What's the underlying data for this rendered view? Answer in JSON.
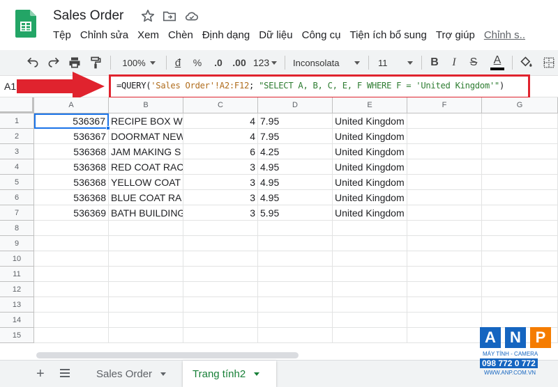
{
  "app": {
    "doc_title": "Sales Order",
    "menu": [
      "Tệp",
      "Chỉnh sửa",
      "Xem",
      "Chèn",
      "Định dạng",
      "Dữ liệu",
      "Công cụ",
      "Tiện ích bổ sung",
      "Trợ giúp",
      "Chỉnh s.."
    ]
  },
  "toolbar": {
    "zoom": "100%",
    "currency": "đ",
    "percent": "%",
    "decrease_decimal": ".0",
    "increase_decimal": ".00",
    "more_formats": "123",
    "font": "Inconsolata",
    "font_size": "11",
    "bold": "B",
    "italic": "I",
    "strike": "S",
    "text_color_letter": "A",
    "text_color": "#000000"
  },
  "formula_bar": {
    "name_box": "A1",
    "formula_prefix": "=QUERY(",
    "formula_range": "'Sales Order'!A2:F12",
    "formula_sep": "; ",
    "formula_query": "\"SELECT A, B, C, E, F WHERE F = 'United Kingdom'\"",
    "formula_suffix": ")"
  },
  "grid": {
    "columns": [
      "A",
      "B",
      "C",
      "D",
      "E",
      "F",
      "G"
    ],
    "rows": [
      "1",
      "2",
      "3",
      "4",
      "5",
      "6",
      "7",
      "8",
      "9",
      "10",
      "11",
      "12",
      "13",
      "14",
      "15"
    ],
    "data": [
      [
        "536367",
        "RECIPE BOX W",
        "4",
        "7.95",
        "United Kingdom"
      ],
      [
        "536367",
        "DOORMAT NEW",
        "4",
        "7.95",
        "United Kingdom"
      ],
      [
        "536368",
        "JAM MAKING S",
        "6",
        "4.25",
        "United Kingdom"
      ],
      [
        "536368",
        "RED COAT RAC",
        "3",
        "4.95",
        "United Kingdom"
      ],
      [
        "536368",
        "YELLOW COAT",
        "3",
        "4.95",
        "United Kingdom"
      ],
      [
        "536368",
        "BLUE COAT RA",
        "3",
        "4.95",
        "United Kingdom"
      ],
      [
        "536369",
        "BATH BUILDING",
        "3",
        "5.95",
        "United Kingdom"
      ]
    ]
  },
  "sheets": {
    "tabs": [
      "Sales Order",
      "Trang tính2"
    ],
    "active": "Trang tính2"
  },
  "watermark": {
    "letters": [
      "A",
      "N",
      "P"
    ],
    "tagline": "MÁY TÍNH - CAMERA",
    "phone": "098 772 0 772",
    "website": "WWW.ANP.COM.VN"
  },
  "colors": {
    "accent_green": "#188038",
    "highlight_red": "#e0232e",
    "selection_blue": "#1a73e8",
    "watermark_blue": "#1565c0",
    "watermark_orange": "#f57c00"
  }
}
